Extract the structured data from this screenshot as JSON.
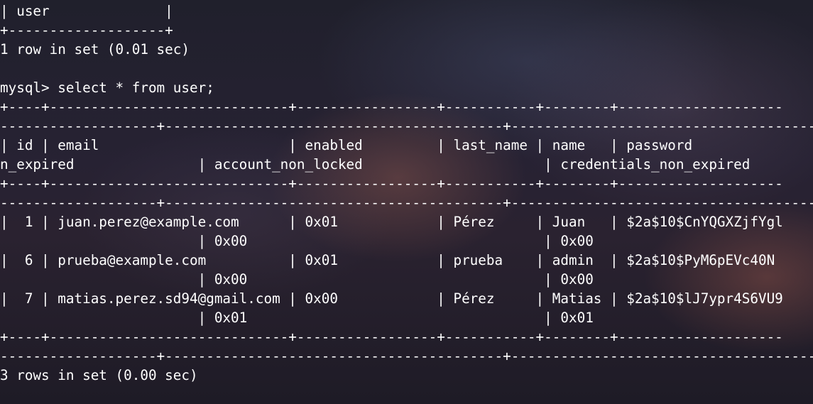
{
  "terminal": {
    "lines": [
      "| user              |",
      "+-------------------+",
      "1 row in set (0.01 sec)",
      "",
      "mysql> select * from user;",
      "+----+-----------------------------+-----------------+-----------+--------+--------------------",
      "-------------------+-----------------------------------------+-------------------------------------",
      "| id | email                       | enabled         | last_name | name   | password",
      "n_expired               | account_non_locked                      | credentials_non_expired",
      "+----+-----------------------------+-----------------+-----------+--------+--------------------",
      "-------------------+-----------------------------------------+-------------------------------------",
      "|  1 | juan.perez@example.com      | 0x01            | Pérez     | Juan   | $2a$10$CnYQGXZjfYgl",
      "                        | 0x00                                    | 0x00",
      "|  6 | prueba@example.com          | 0x01            | prueba    | admin  | $2a$10$PyM6pEVc40N",
      "                        | 0x00                                    | 0x00",
      "|  7 | matias.perez.sd94@gmail.com | 0x00            | Pérez     | Matias | $2a$10$lJ7ypr4S6VU9",
      "                        | 0x01                                    | 0x01",
      "+----+-----------------------------+-----------------+-----------+--------+--------------------",
      "-------------------+-----------------------------------------+-------------------------------------",
      "3 rows in set (0.00 sec)"
    ]
  }
}
